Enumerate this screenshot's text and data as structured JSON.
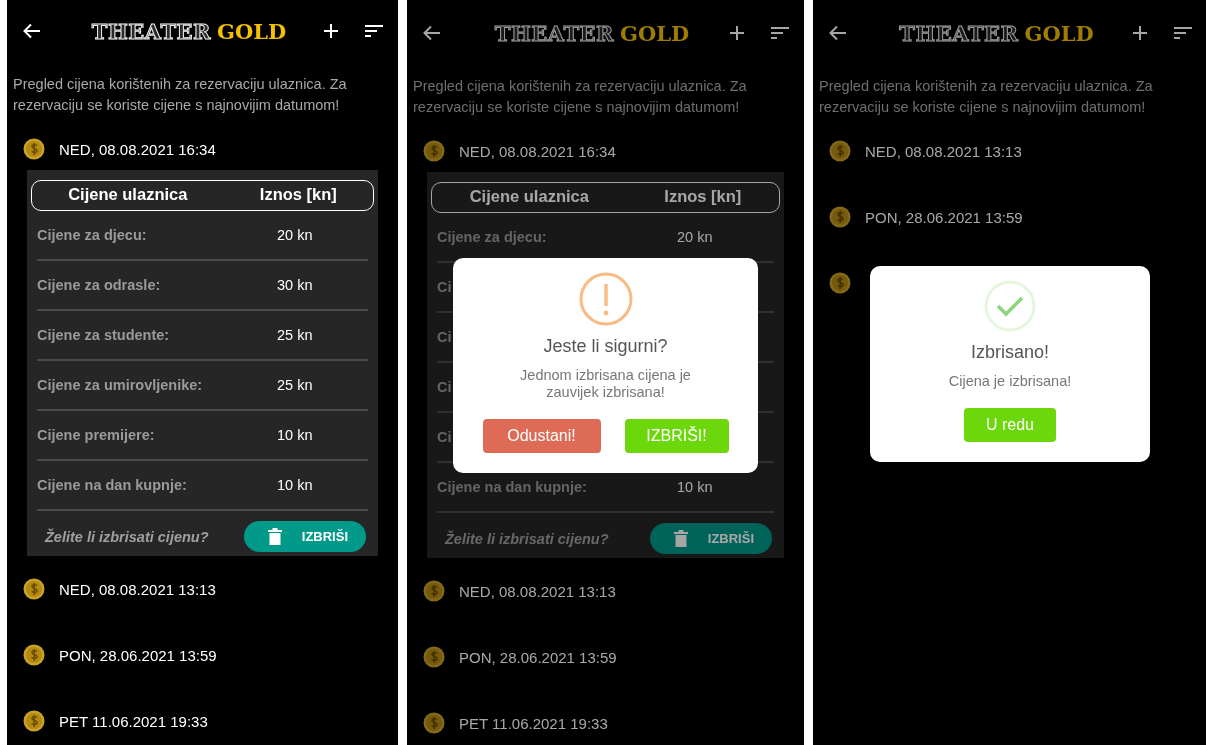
{
  "screens": [
    {
      "header": {
        "logo_outline": "THEATER",
        "logo_gold": "GOLD"
      },
      "intro": "Pregled cijena korištenih za rezervaciju ulaznica. Za rezervaciju se koriste cijene s najnovijim datumom!",
      "entries": [
        {
          "date": "NED, 08.08.2021 16:34",
          "expanded": true,
          "table": {
            "columns": [
              "Cijene ulaznica",
              "Iznos [kn]"
            ],
            "rows": [
              {
                "label": "Cijene za djecu:",
                "value": "20 kn"
              },
              {
                "label": "Cijene za odrasle:",
                "value": "30 kn"
              },
              {
                "label": "Cijene za studente:",
                "value": "25 kn"
              },
              {
                "label": "Cijene za umirovljenike:",
                "value": "25 kn"
              },
              {
                "label": "Cijene premijere:",
                "value": "10 kn"
              },
              {
                "label": "Cijene na dan kupnje:",
                "value": "10 kn"
              }
            ],
            "question": "Želite li izbrisati cijenu?",
            "delete_button": "IZBRIŠI"
          }
        },
        {
          "date": "NED, 08.08.2021 13:13",
          "expanded": false
        },
        {
          "date": "PON, 28.06.2021 13:59",
          "expanded": false
        },
        {
          "date": "PET 11.06.2021 19:33",
          "expanded": false
        }
      ]
    },
    {
      "header": {
        "logo_outline": "THEATER",
        "logo_gold": "GOLD"
      },
      "intro": "Pregled cijena korištenih za rezervaciju ulaznica. Za rezervaciju se koriste cijene s najnovijim datumom!",
      "entries": [
        {
          "date": "NED, 08.08.2021 16:34",
          "expanded": true,
          "table": {
            "columns": [
              "Cijene ulaznica",
              "Iznos [kn]"
            ],
            "rows": [
              {
                "label": "Cijene za djecu:",
                "value": "20 kn"
              },
              {
                "label": "Ci"
              },
              {
                "label": "Ci"
              },
              {
                "label": "Ci"
              },
              {
                "label": "Ci"
              },
              {
                "label": "Cijene na dan kupnje:",
                "value": "10 kn"
              }
            ],
            "question": "Želite li izbrisati cijenu?",
            "delete_button": "IZBRIŠI"
          }
        },
        {
          "date": "NED, 08.08.2021 13:13",
          "expanded": false
        },
        {
          "date": "PON, 28.06.2021 13:59",
          "expanded": false
        },
        {
          "date": "PET 11.06.2021 19:33",
          "expanded": false
        }
      ],
      "dialog": {
        "kind": "warning",
        "title": "Jeste li sigurni?",
        "message": "Jednom izbrisana cijena je zauvijek izbrisana!",
        "cancel_button": "Odustani!",
        "confirm_button": "IZBRIŠI!"
      }
    },
    {
      "header": {
        "logo_outline": "THEATER",
        "logo_gold": "GOLD"
      },
      "intro": "Pregled cijena korištenih za rezervaciju ulaznica. Za rezervaciju se koriste cijene s najnovijim datumom!",
      "entries": [
        {
          "date": "NED, 08.08.2021 13:13",
          "expanded": false
        },
        {
          "date": "PON, 28.06.2021 13:59",
          "expanded": false
        },
        {
          "expanded": false
        }
      ],
      "dialog": {
        "kind": "success",
        "title": "Izbrisano!",
        "message": "Cijena je izbrisana!",
        "confirm_button": "U redu"
      }
    }
  ]
}
